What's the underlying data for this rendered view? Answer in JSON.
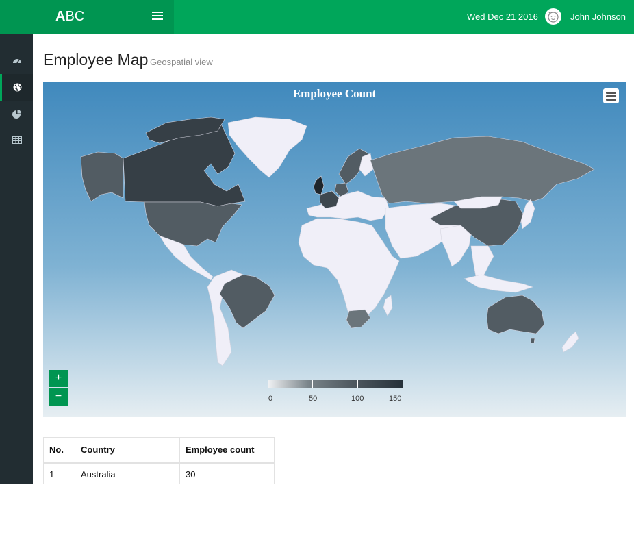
{
  "header": {
    "logo_bold": "A",
    "logo_rest": "BC",
    "date": "Wed Dec 21 2016",
    "user_name": "John Johnson",
    "avatar_icon": "smiley-face-icon"
  },
  "sidebar": {
    "items": [
      {
        "icon": "dashboard-icon",
        "active": false
      },
      {
        "icon": "globe-icon",
        "active": true
      },
      {
        "icon": "pie-chart-icon",
        "active": false
      },
      {
        "icon": "table-icon",
        "active": false
      }
    ]
  },
  "page": {
    "title": "Employee Map",
    "subtitle": "Geospatial view"
  },
  "map": {
    "title": "Employee Count",
    "zoom_in": "+",
    "zoom_out": "−",
    "legend_ticks": [
      "0",
      "50",
      "100",
      "150"
    ],
    "colors": {
      "ocean_top": "#4089bd",
      "land_default": "#f0eff8",
      "highlight_low": "#6b757b",
      "highlight_high": "#26313a"
    }
  },
  "table": {
    "headers": [
      "No.",
      "Country",
      "Employee count"
    ],
    "rows": [
      [
        "1",
        "Australia",
        "30"
      ]
    ]
  },
  "colors": {
    "brand_green": "#00a65a",
    "brand_green_dark": "#009551",
    "sidebar_bg": "#222d32"
  }
}
